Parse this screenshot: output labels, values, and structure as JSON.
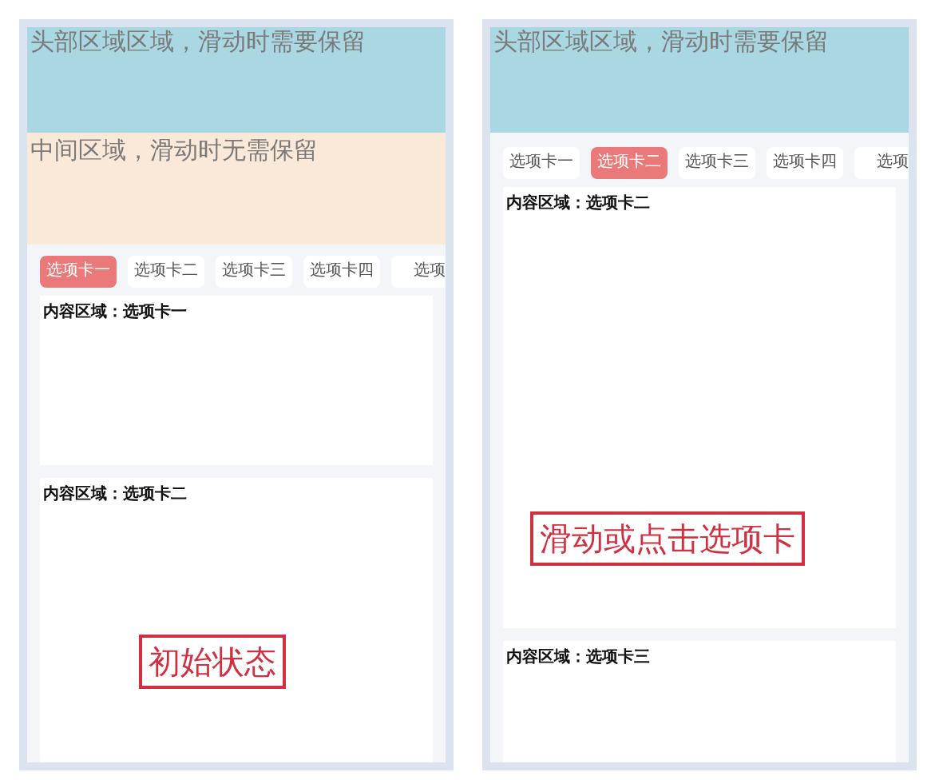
{
  "panels": [
    {
      "header": "头部区域区域，滑动时需要保留",
      "middle": "中间区域，滑动时无需保留",
      "tabs": [
        {
          "label": "选项卡一",
          "selected": true
        },
        {
          "label": "选项卡二",
          "selected": false
        },
        {
          "label": "选项卡三",
          "selected": false
        },
        {
          "label": "选项卡四",
          "selected": false
        },
        {
          "label": "选项",
          "selected": false
        }
      ],
      "cards": [
        "内容区域：选项卡一",
        "内容区域：选项卡二"
      ],
      "annotation": "初始状态"
    },
    {
      "header": "头部区域区域，滑动时需要保留",
      "tabs": [
        {
          "label": "选项卡一",
          "selected": false
        },
        {
          "label": "选项卡二",
          "selected": true
        },
        {
          "label": "选项卡三",
          "selected": false
        },
        {
          "label": "选项卡四",
          "selected": false
        },
        {
          "label": "选项",
          "selected": false
        }
      ],
      "cards": [
        "内容区域：选项卡二",
        "内容区域：选项卡三"
      ],
      "annotation": "滑动或点击选项卡"
    }
  ]
}
